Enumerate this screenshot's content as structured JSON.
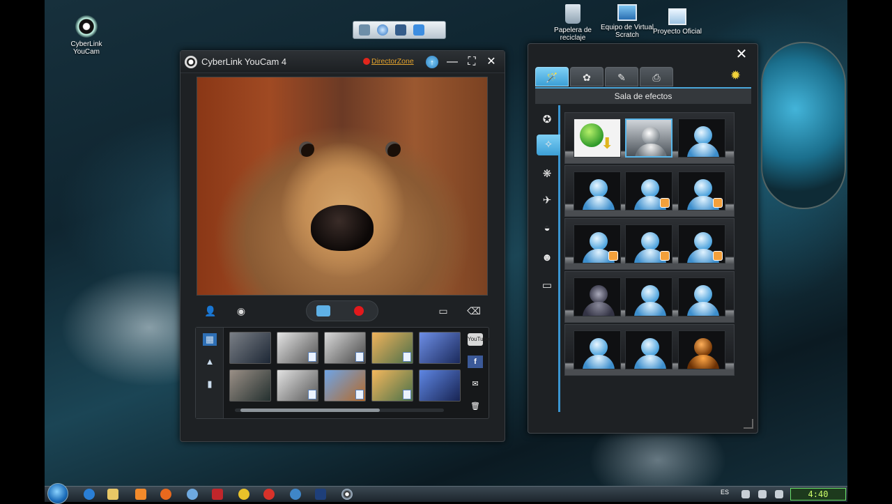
{
  "desktop": {
    "icons": [
      {
        "label": "CyberLink YouCam",
        "icon": "youcam-icon"
      },
      {
        "label": "Papelera de reciclaje",
        "icon": "recycle-bin-icon"
      },
      {
        "label": "Equipo de Virtual Scratch",
        "icon": "computer-icon"
      },
      {
        "label": "Proyecto Oficial",
        "icon": "folder-icon"
      }
    ]
  },
  "youcam": {
    "title": "CyberLink YouCam 4",
    "director_zone": "DirectorZone",
    "share_youtube": "YouTube",
    "share_facebook": "f"
  },
  "effects": {
    "header": "Sala de efectos",
    "tabs": [
      {
        "icon": "magic-wand-icon",
        "active": true
      },
      {
        "icon": "sparkle-icon",
        "active": false
      },
      {
        "icon": "pencil-icon",
        "active": false
      },
      {
        "icon": "camera-icon",
        "active": false
      }
    ],
    "categories": [
      "star-face-icon",
      "magic-wand-icon",
      "particles-icon",
      "bird-icon",
      "mask-icon",
      "smiley-icon",
      "frame-icon"
    ],
    "rows": [
      [
        "download-effect",
        "silhouette-selected",
        "bubbles"
      ],
      [
        "silhouette",
        "silhouette-confetti",
        "silhouette-flowers"
      ],
      [
        "silhouette-hearts",
        "silhouette-stars",
        "silhouette-sparks"
      ],
      [
        "glass-silhouette",
        "crystal-silhouette",
        "blur-silhouette"
      ],
      [
        "pixel-silhouette",
        "snow-silhouette",
        "orange-silhouette"
      ]
    ]
  },
  "taskbar": {
    "language": "ES",
    "clock": "4:40"
  },
  "colors": {
    "accent": "#3c9fd6",
    "record": "#e3191c",
    "director_zone": "#e4a32c"
  }
}
